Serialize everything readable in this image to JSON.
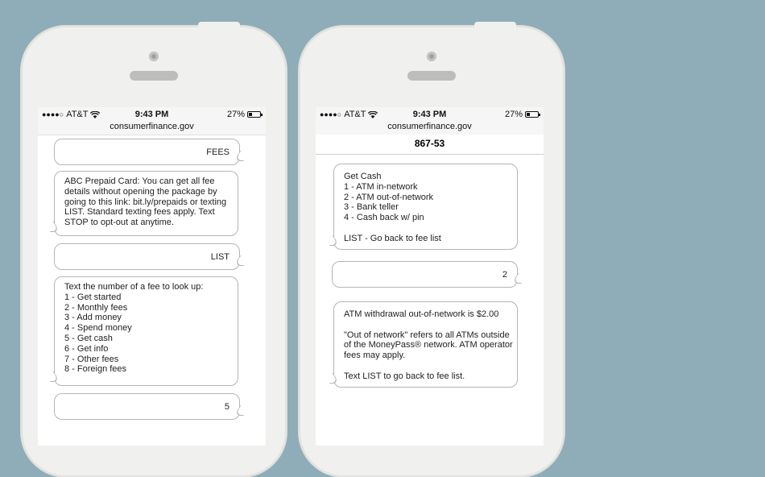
{
  "left_phone": {
    "status": {
      "carrier": "AT&T",
      "time": "9:43 PM",
      "battery": "27%",
      "url": "consumerfinance.gov"
    },
    "messages": [
      {
        "from": "user",
        "text": [
          "FEES"
        ]
      },
      {
        "from": "bot",
        "text": [
          "ABC Prepaid Card: You can get all fee",
          "details without opening the package by",
          "going to this link: bit.ly/prepaids or texting",
          "LIST. Standard texting fees apply. Text",
          "STOP to opt-out at anytime."
        ]
      },
      {
        "from": "user",
        "text": [
          "LIST"
        ]
      },
      {
        "from": "bot",
        "text": [
          "Text the number of a fee to look up:",
          "1 - Get started",
          "2 - Monthly fees",
          "3 - Add money",
          "4 - Spend money",
          "5 - Get cash",
          "6 - Get info",
          "7 - Other fees",
          "8 - Foreign fees"
        ]
      },
      {
        "from": "user",
        "text": [
          "5"
        ]
      }
    ]
  },
  "right_phone": {
    "status": {
      "carrier": "AT&T",
      "time": "9:43 PM",
      "battery": "27%",
      "url": "consumerfinance.gov"
    },
    "title": "867-53",
    "messages": [
      {
        "from": "bot",
        "text": [
          "Get Cash",
          "1 - ATM in-network",
          "2 - ATM out-of-network",
          "3 - Bank teller",
          "4 - Cash back w/ pin",
          "",
          "LIST - Go back to fee list"
        ]
      },
      {
        "from": "user",
        "text": [
          "2"
        ]
      },
      {
        "from": "bot",
        "text": [
          "ATM withdrawal out-of-network is $2.00",
          "",
          "\"Out of network\" refers to all ATMs outside",
          "of the MoneyPass® network. ATM operator",
          "fees may apply.",
          "",
          "Text LIST to go back to fee list."
        ]
      }
    ]
  }
}
